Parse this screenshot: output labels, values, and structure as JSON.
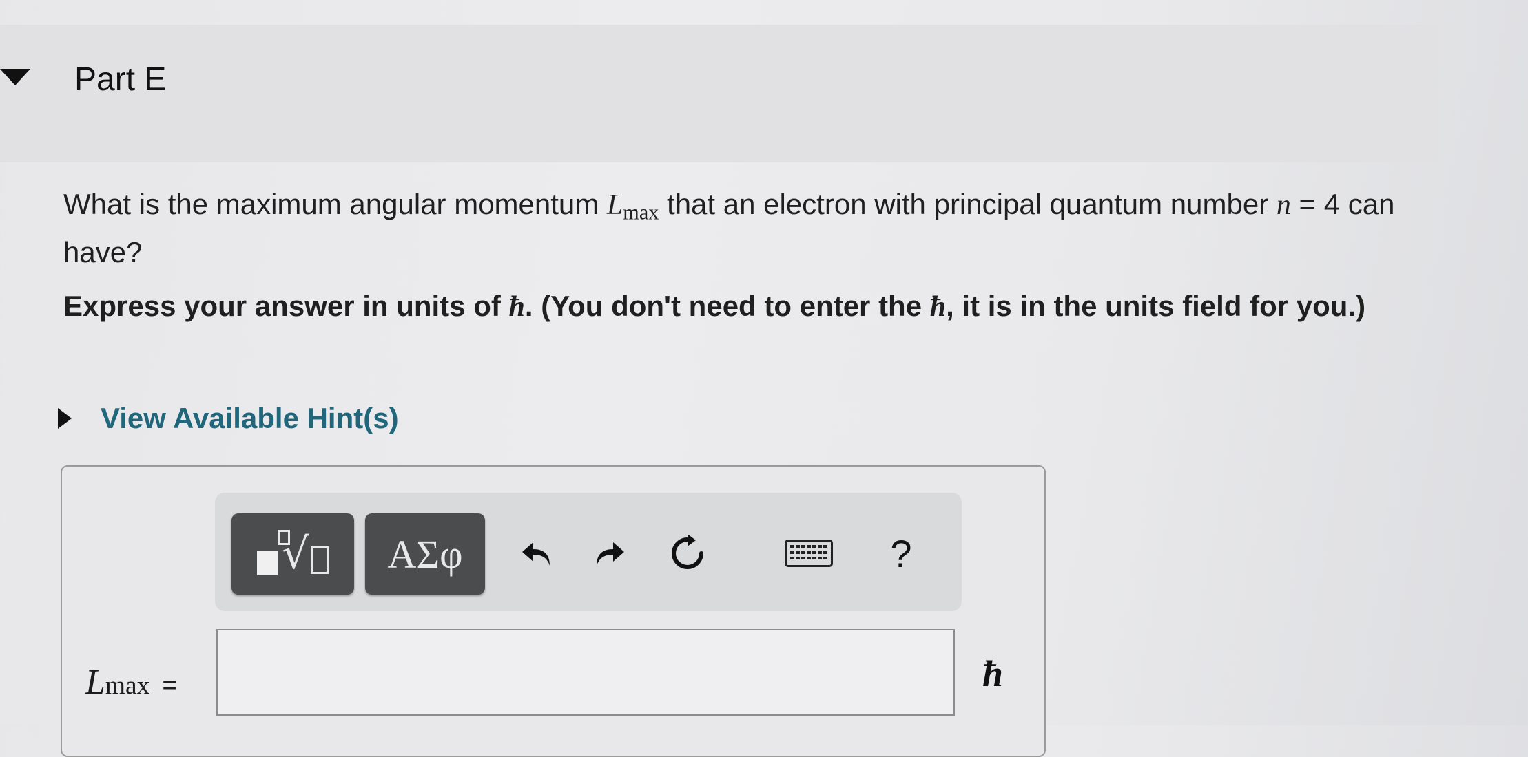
{
  "part": {
    "title": "Part E"
  },
  "question": {
    "text_before": "What is the maximum angular momentum ",
    "var_main": "L",
    "var_sub": "max",
    "text_middle": " that an electron with principal quantum number ",
    "n_var": "n",
    "text_after": " = 4 can have?"
  },
  "instruction": {
    "text_1": "Express your answer in units of ",
    "hbar_1": "ħ",
    "text_2": ". (You don't need to enter the ",
    "hbar_2": "ħ",
    "text_3": ", it is in the units field for you.)"
  },
  "hints": {
    "label": "View Available Hint(s)"
  },
  "toolbar": {
    "symbols_label": "ΑΣφ",
    "sqrt_glyph": "√",
    "help_label": "?",
    "icons": [
      "templates-icon",
      "symbols-icon",
      "undo-icon",
      "redo-icon",
      "reset-icon",
      "keyboard-icon",
      "help-icon"
    ]
  },
  "answer": {
    "label_main": "L",
    "label_sub": "max",
    "label_eq": "=",
    "value": "",
    "units": "ħ"
  },
  "colors": {
    "hint_link": "#20677c",
    "toolbar_button": "#4b4c4e",
    "header_band": "#e1e1e3"
  }
}
